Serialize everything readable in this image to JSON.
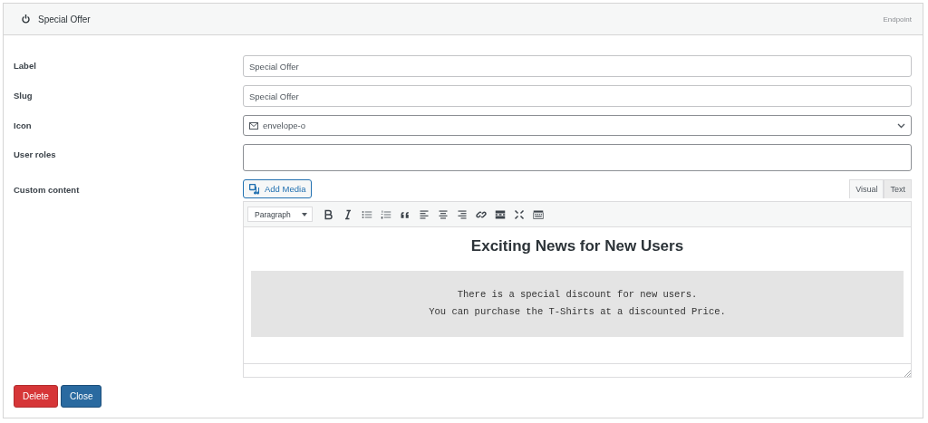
{
  "header": {
    "title": "Special Offer",
    "endpoint": "Endpoint"
  },
  "fields": [
    {
      "kind": "text",
      "label": "Label",
      "value": "Special Offer"
    },
    {
      "kind": "text",
      "label": "Slug",
      "value": "Special Offer"
    },
    {
      "kind": "select",
      "label": "Icon",
      "value": "envelope-o"
    },
    {
      "kind": "tall",
      "label": "User roles"
    },
    {
      "kind": "editor",
      "label": "Custom content"
    }
  ],
  "editor": {
    "add_media": "Add Media",
    "tabs": [
      {
        "label": "Visual",
        "selected": true
      },
      {
        "label": "Text",
        "selected": false
      }
    ],
    "format": "Paragraph",
    "heading": "Exciting News for New Users",
    "preformatted": [
      "There is a special discount for new users.",
      "You can purchase the T-Shirts at a discounted Price."
    ]
  },
  "buttons": [
    {
      "label": "Delete",
      "kind": "danger"
    },
    {
      "label": "Close",
      "kind": "primary"
    }
  ]
}
